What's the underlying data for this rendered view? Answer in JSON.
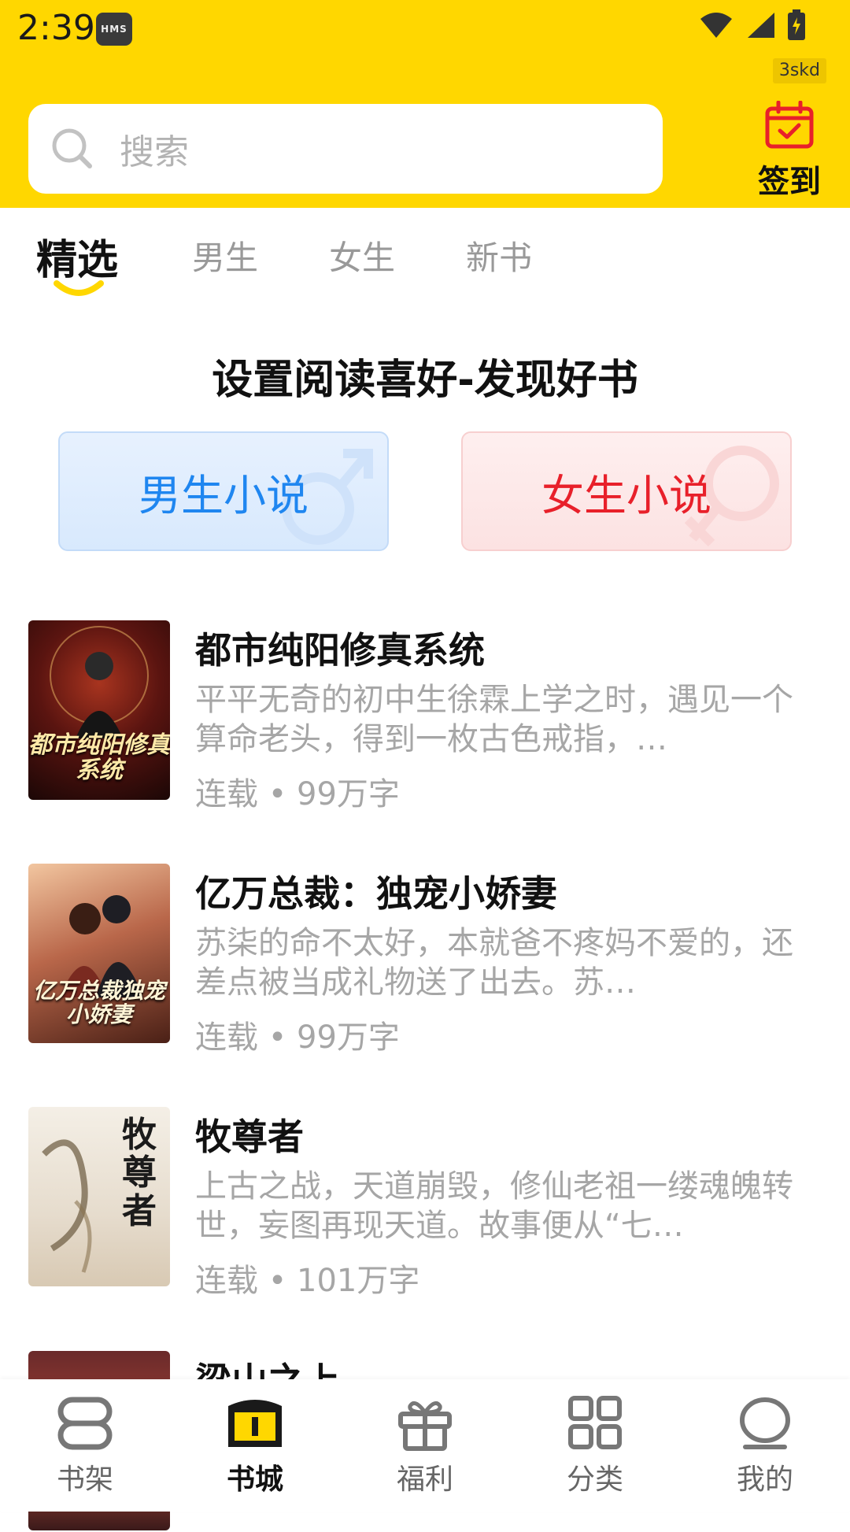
{
  "status_bar": {
    "time": "2:39",
    "badge": "HMS",
    "tag": "3skd"
  },
  "header": {
    "search_placeholder": "搜索",
    "signin_label": "签到"
  },
  "tabs": [
    {
      "label": "精选",
      "active": true
    },
    {
      "label": "男生",
      "active": false
    },
    {
      "label": "女生",
      "active": false
    },
    {
      "label": "新书",
      "active": false
    }
  ],
  "preference": {
    "title": "设置阅读喜好-发现好书",
    "male_label": "男生小说",
    "female_label": "女生小说"
  },
  "books": [
    {
      "title": "都市纯阳修真系统",
      "description": "平平无奇的初中生徐霖上学之时，遇见一个算命老头，得到一枚古色戒指，…",
      "meta": "连载 • 99万字",
      "cover_text": "都市纯阳修真系统"
    },
    {
      "title": "亿万总裁：独宠小娇妻",
      "description": "苏柒的命不太好，本就爸不疼妈不爱的，还差点被当成礼物送了出去。苏…",
      "meta": "连载 • 99万字",
      "cover_text": "亿万总裁独宠小娇妻"
    },
    {
      "title": "牧尊者",
      "description": "上古之战，天道崩毁，修仙老祖一缕魂魄转世，妄图再现天道。故事便从“七…",
      "meta": "连载 • 101万字",
      "cover_text": "牧尊者"
    },
    {
      "title": "梁山之上",
      "description": "",
      "meta": "",
      "cover_text": ""
    }
  ],
  "bottom_nav": [
    {
      "label": "书架",
      "icon": "bookshelf-icon",
      "active": false
    },
    {
      "label": "书城",
      "icon": "bookstore-icon",
      "active": true
    },
    {
      "label": "福利",
      "icon": "gift-icon",
      "active": false
    },
    {
      "label": "分类",
      "icon": "category-icon",
      "active": false
    },
    {
      "label": "我的",
      "icon": "profile-icon",
      "active": false
    }
  ],
  "colors": {
    "brand_yellow": "#FFD700",
    "male_blue": "#1F86F0",
    "female_red": "#E8202A"
  }
}
